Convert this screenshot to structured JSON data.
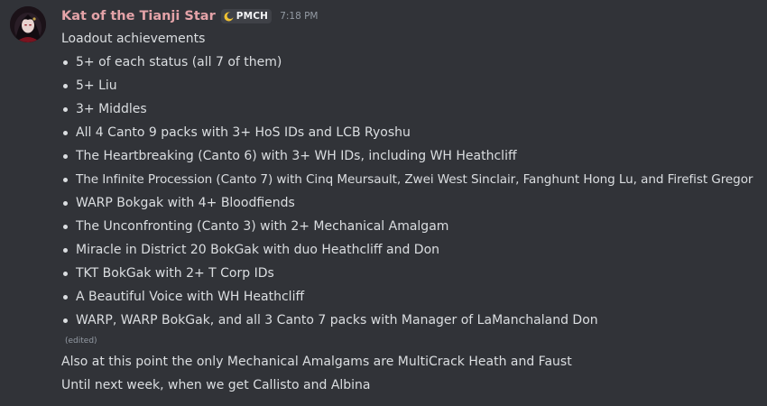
{
  "message": {
    "author": "Kat of the Tianji Star",
    "tag": "PMCH",
    "timestamp": "7:18 PM",
    "intro": "Loadout achievements",
    "items": [
      "5+ of each status (all 7 of them)",
      "5+ Liu",
      "3+ Middles",
      "All 4 Canto 9 packs with 3+ HoS IDs and LCB Ryoshu",
      "The Heartbreaking (Canto 6) with 3+ WH IDs, including WH Heathcliff",
      "The Infinite Procession (Canto 7) with Cinq Meursault, Zwei West Sinclair, Fanghunt Hong Lu, and Firefist Gregor",
      "WARP Bokgak with 4+ Bloodfiends",
      "The Unconfronting (Canto 3) with 2+ Mechanical Amalgam",
      "Miracle in District 20 BokGak with duo Heathcliff and Don",
      "TKT BokGak with 2+ T Corp IDs",
      "A Beautiful Voice with WH Heathcliff",
      "WARP, WARP BokGak, and all 3 Canto 7 packs with Manager of LaManchaland Don"
    ],
    "edited_label": "(edited)",
    "followups": [
      "Also at this point the only Mechanical Amalgams are MultiCrack Heath and Faust",
      "Until next week, when we get Callisto and Albina"
    ]
  },
  "colors": {
    "background": "#313338",
    "text": "#dbdee1",
    "username": "#e4a3a8",
    "muted": "#949ba4",
    "tag_background": "#3f4147"
  },
  "icons": {
    "avatar": "avatar-image",
    "tag_icon": "crescent-moon-icon"
  }
}
